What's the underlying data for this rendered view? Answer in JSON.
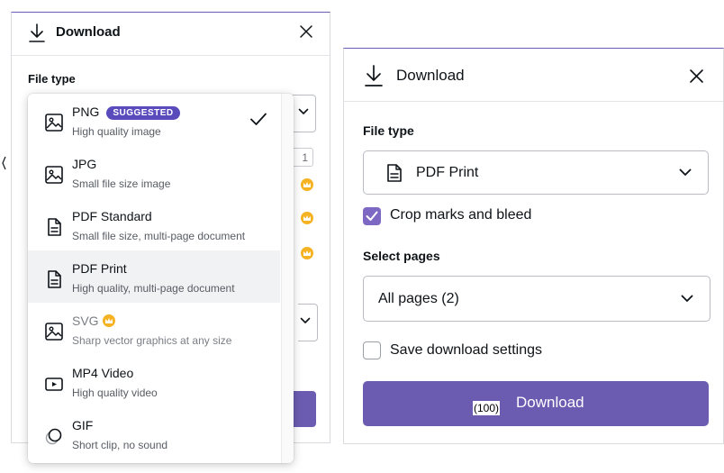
{
  "left_panel": {
    "title": "Download",
    "file_type_label": "File type",
    "size_value": "1"
  },
  "dropdown": {
    "items": [
      {
        "name": "PNG",
        "badge": "SUGGESTED",
        "desc": "High quality image",
        "icon": "image-icon",
        "checked": true
      },
      {
        "name": "JPG",
        "desc": "Small file size image",
        "icon": "image-icon"
      },
      {
        "name": "PDF Standard",
        "desc": "Small file size, multi-page document",
        "icon": "document-icon"
      },
      {
        "name": "PDF Print",
        "desc": "High quality, multi-page document",
        "icon": "document-icon",
        "hovered": true
      },
      {
        "name": "SVG",
        "desc": "Sharp vector graphics at any size",
        "icon": "image-icon",
        "premium": true
      },
      {
        "name": "MP4 Video",
        "desc": "High quality video",
        "icon": "video-icon"
      },
      {
        "name": "GIF",
        "desc": "Short clip, no sound",
        "icon": "gif-icon"
      }
    ]
  },
  "right_panel": {
    "title": "Download",
    "file_type_label": "File type",
    "file_type_value": "PDF Print",
    "crop_marks_label": "Crop marks and bleed",
    "crop_marks_checked": true,
    "select_pages_label": "Select pages",
    "pages_value": "All pages (2)",
    "save_settings_label": "Save download settings",
    "save_settings_checked": false,
    "download_button": "Download",
    "overlay_tag": "(100)"
  },
  "colors": {
    "accent": "#6b5cb1",
    "badge": "#5a4bbd",
    "checkbox": "#7d69c4",
    "premium_crown": "#f5b324"
  }
}
